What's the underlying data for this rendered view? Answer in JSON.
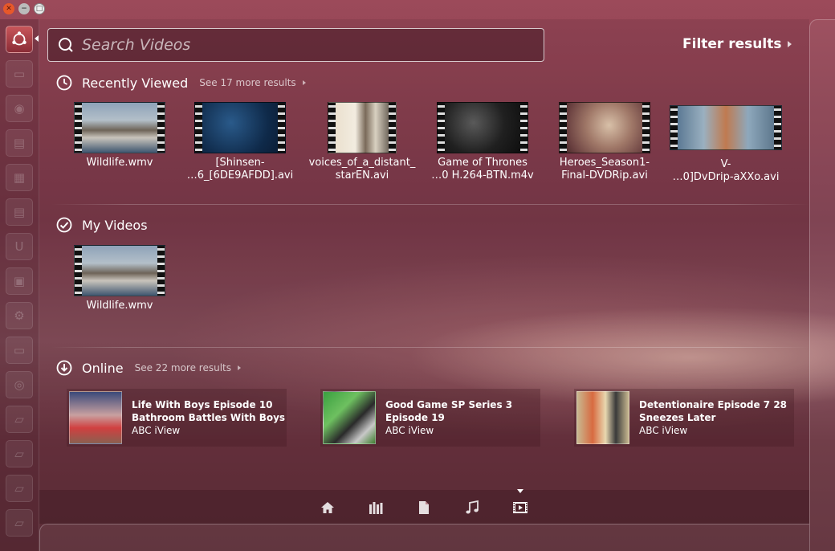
{
  "search": {
    "placeholder": "Search Videos",
    "value": ""
  },
  "filter": {
    "label": "Filter results"
  },
  "sections": {
    "recent": {
      "title": "Recently Viewed",
      "more": "See 17 more results"
    },
    "my": {
      "title": "My Videos"
    },
    "online": {
      "title": "Online",
      "more": "See 22 more results"
    }
  },
  "recent_videos": [
    {
      "line1": "Wildlife.wmv",
      "line2": ""
    },
    {
      "line1": "[Shinsen-",
      "line2": "…6_[6DE9AFDD].avi"
    },
    {
      "line1": "voices_of_a_distant_",
      "line2": "starEN.avi"
    },
    {
      "line1": "Game of Thrones",
      "line2": "…0 H.264-BTN.m4v"
    },
    {
      "line1": "Heroes_Season1-",
      "line2": "Final-DVDRip.avi"
    },
    {
      "line1": "V-",
      "line2": "…0]DvDrip-aXXo.avi"
    }
  ],
  "my_videos": [
    {
      "line1": "Wildlife.wmv"
    }
  ],
  "online_videos": [
    {
      "title": "Life With Boys Episode 10 Bathroom Battles With Boys",
      "source": "ABC iView"
    },
    {
      "title": "Good Game SP Series 3 Episode 19",
      "source": "ABC iView"
    },
    {
      "title": "Detentionaire Episode 7 28 Sneezes Later",
      "source": "ABC iView"
    }
  ],
  "lenses": [
    "home-icon",
    "applications-icon",
    "files-icon",
    "music-icon",
    "video-icon"
  ],
  "launcher_icons": [
    "ubuntu-icon",
    "folder-icon",
    "disk-icon",
    "document-icon",
    "spreadsheet-icon",
    "presentation-icon",
    "ubuntu-one-icon",
    "software-center-icon",
    "settings-icon",
    "monitor-icon",
    "cd-icon",
    "drive-icon",
    "drive-icon",
    "drive-icon",
    "drive-icon",
    "trash-icon"
  ],
  "colors": {
    "accent": "#c8565a",
    "close": "#e8582a"
  }
}
